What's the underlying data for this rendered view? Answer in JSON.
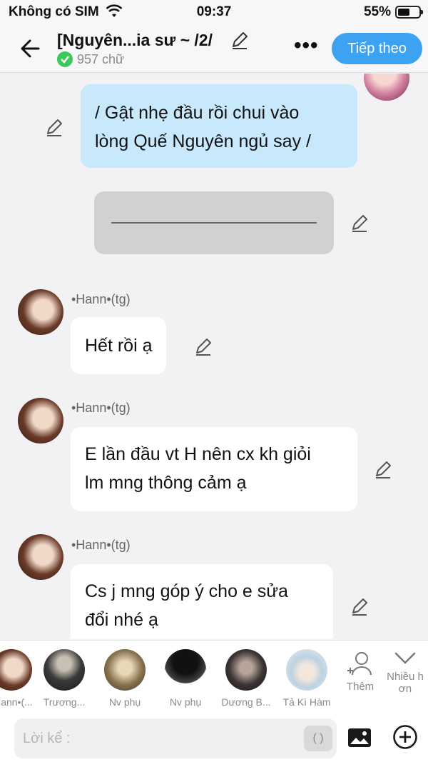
{
  "status_bar": {
    "carrier": "Không có SIM",
    "time": "09:37",
    "battery": "55%"
  },
  "header": {
    "title": "[Nguyên...ia sư ~ /2/",
    "word_count": "957 chữ",
    "next_label": "Tiếp theo",
    "accent_color": "#3ca2f1"
  },
  "messages": [
    {
      "type": "narration",
      "text_line1": "/ Gật nhẹ đầu rồi chui vào",
      "text_line2": "lòng Quế Nguyên ngủ say /"
    },
    {
      "type": "separator"
    },
    {
      "type": "message",
      "author": "•Hann•(tg)",
      "text": "Hết rồi ạ"
    },
    {
      "type": "message",
      "author": "•Hann•(tg)",
      "text_line1": "E lần đầu vt H nên cx kh giỏi",
      "text_line2": "lm mng thông cảm ạ"
    },
    {
      "type": "message",
      "author": "•Hann•(tg)",
      "text_line1": "Cs j mng góp ý cho e sửa",
      "text_line2": "đổi nhé ạ"
    }
  ],
  "characters": [
    {
      "label": "•Hann•(..."
    },
    {
      "label": "Trương..."
    },
    {
      "label": "Nv phụ"
    },
    {
      "label": "Nv phụ"
    },
    {
      "label": "Dương B..."
    },
    {
      "label": "Tả Kì Hàm"
    }
  ],
  "strip_actions": {
    "add_label": "Thêm",
    "more_label_1": "Nhiều h",
    "more_label_2": "ơn"
  },
  "input": {
    "placeholder": "Lời kể :",
    "paren_label": "( )"
  }
}
